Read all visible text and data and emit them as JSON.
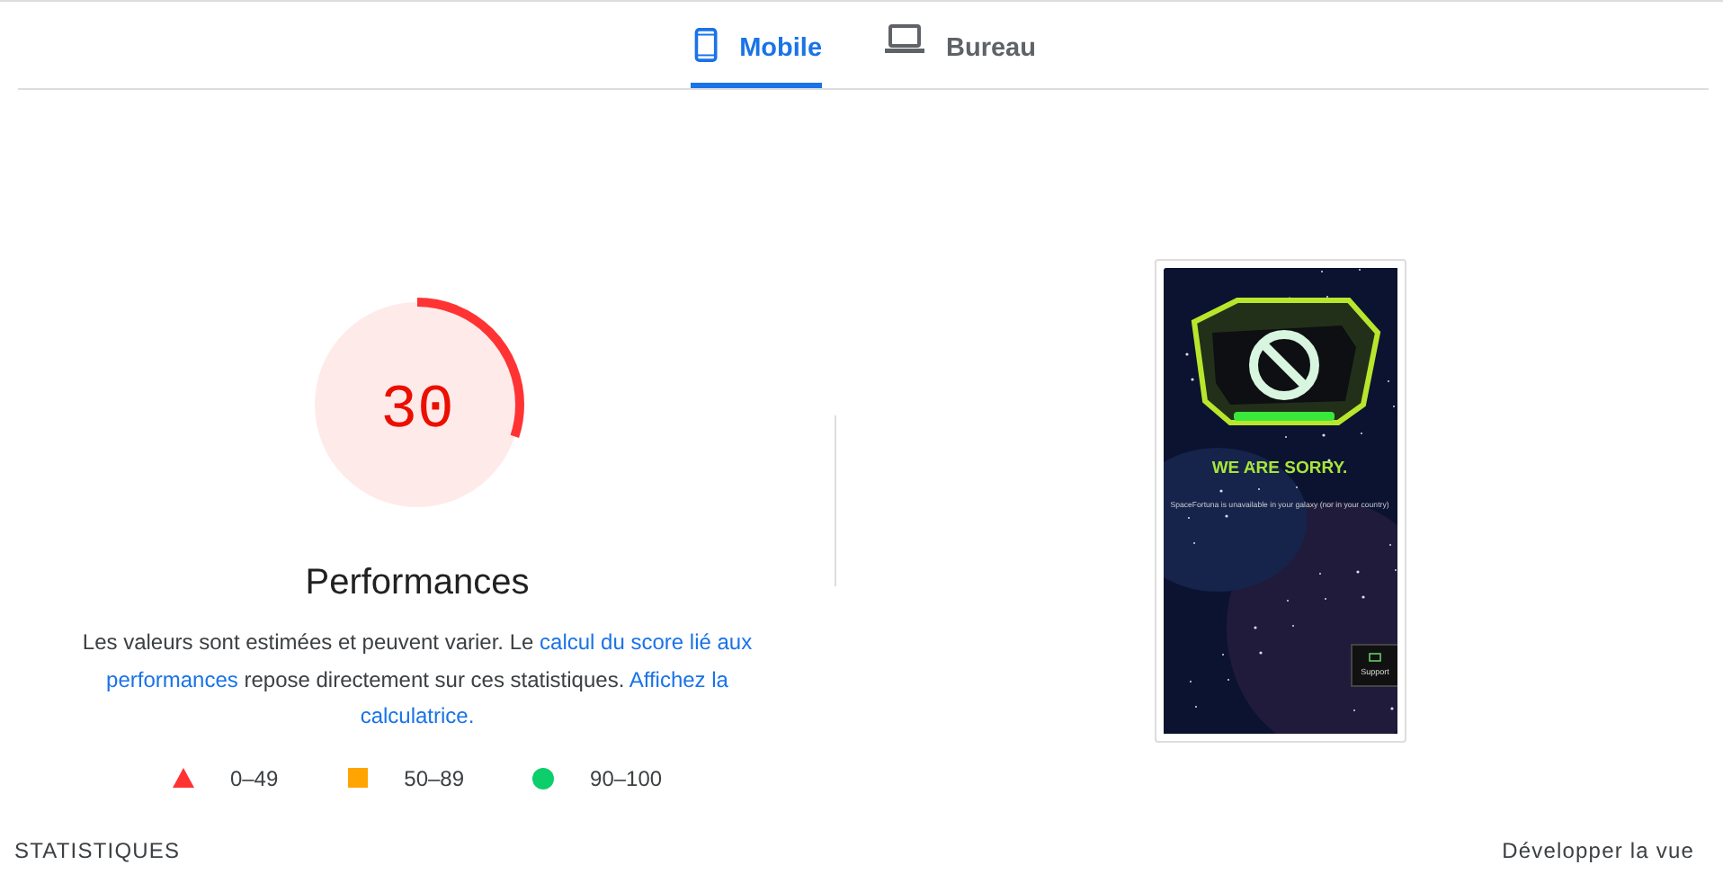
{
  "tabs": [
    {
      "label": "Mobile",
      "selected": true
    },
    {
      "label": "Bureau",
      "selected": false
    }
  ],
  "gauge": {
    "value": "30",
    "level": 0.3,
    "title": "Performances"
  },
  "description": [
    {
      "text": "Les valeurs sont estimées et peuvent varier. Le ",
      "link": false
    },
    {
      "text": "calcul du score lié aux performances",
      "link": true
    },
    {
      "text": " repose directement sur ces statistiques. ",
      "link": false
    },
    {
      "text": "Affichez la calculatrice.",
      "link": true
    }
  ],
  "legend": [
    {
      "kind": "triangle",
      "color": "#ff3333",
      "label": "0–49"
    },
    {
      "kind": "square",
      "color": "#ffa400",
      "label": "50–89"
    },
    {
      "kind": "circle",
      "color": "#0cce6b",
      "label": "90–100"
    }
  ],
  "screenshot": {
    "heading": "WE ARE SORRY.",
    "message": "SpaceFortuna is unavailable in your galaxy (nor in your country)",
    "support": "Support"
  },
  "footer": {
    "section": "STATISTIQUES",
    "action": "Développer la vue"
  }
}
